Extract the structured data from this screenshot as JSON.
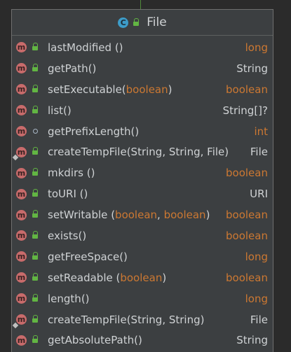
{
  "panel": {
    "title": "File",
    "title_icon": "class-icon",
    "title_icon_letter": "C"
  },
  "colors": {
    "background": "#2b2b2b",
    "panel": "#3c3f41",
    "text": "#cfd2d4",
    "keyword": "#cc7832",
    "method_icon": "#c86b6b",
    "class_icon": "#3d9cc8",
    "public_lock": "#62b543"
  },
  "method_icon_letter": "m",
  "methods": [
    {
      "name": "lastModified",
      "pre": " ()",
      "params": [],
      "ret": "long",
      "prim": true,
      "vis": "public",
      "static": false
    },
    {
      "name": "getPath",
      "pre": "()",
      "params": [],
      "ret": "String",
      "prim": false,
      "vis": "public",
      "static": false
    },
    {
      "name": "setExecutable",
      "pre": "(",
      "params": [
        "boolean"
      ],
      "post": ")",
      "ret": "boolean",
      "prim": true,
      "vis": "public",
      "static": false
    },
    {
      "name": "list",
      "pre": "()",
      "params": [],
      "ret": "String[]?",
      "prim": false,
      "vis": "public",
      "static": false
    },
    {
      "name": "getPrefixLength",
      "pre": "()",
      "params": [],
      "ret": "int",
      "prim": true,
      "vis": "package",
      "static": false
    },
    {
      "name": "createTempFile",
      "pre": "(String, String, File)",
      "params": [],
      "ret": "File",
      "prim": false,
      "vis": "public",
      "static": true
    },
    {
      "name": "mkdirs",
      "pre": " ()",
      "params": [],
      "ret": "boolean",
      "prim": true,
      "vis": "public",
      "static": false
    },
    {
      "name": "toURI",
      "pre": " ()",
      "params": [],
      "ret": "URI",
      "prim": false,
      "vis": "public",
      "static": false
    },
    {
      "name": "setWritable",
      "pre": " (",
      "params": [
        "boolean",
        ", ",
        "boolean"
      ],
      "post": ")",
      "ret": "boolean",
      "prim": true,
      "vis": "public",
      "static": false
    },
    {
      "name": "exists",
      "pre": "()",
      "params": [],
      "ret": "boolean",
      "prim": true,
      "vis": "public",
      "static": false
    },
    {
      "name": "getFreeSpace",
      "pre": "()",
      "params": [],
      "ret": "long",
      "prim": true,
      "vis": "public",
      "static": false
    },
    {
      "name": "setReadable",
      "pre": " (",
      "params": [
        "boolean"
      ],
      "post": ")",
      "ret": "boolean",
      "prim": true,
      "vis": "public",
      "static": false
    },
    {
      "name": "length",
      "pre": "()",
      "params": [],
      "ret": "long",
      "prim": true,
      "vis": "public",
      "static": false
    },
    {
      "name": "createTempFile",
      "pre": "(String, String)",
      "params": [],
      "ret": "File",
      "prim": false,
      "vis": "public",
      "static": true
    },
    {
      "name": "getAbsolutePath",
      "pre": "()",
      "params": [],
      "ret": "String",
      "prim": false,
      "vis": "public",
      "static": false
    }
  ]
}
